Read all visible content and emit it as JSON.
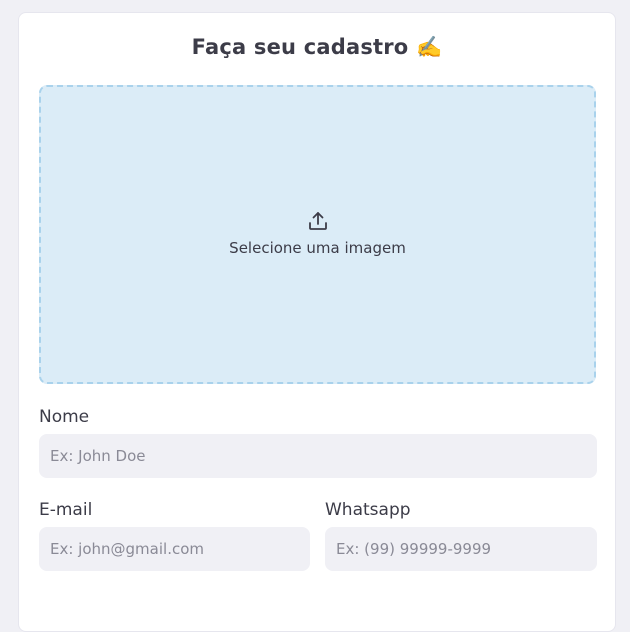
{
  "form": {
    "title": "Faça seu cadastro",
    "title_emoji": "✍️",
    "upload": {
      "icon": "upload-icon",
      "label": "Selecione uma imagem"
    },
    "fields": {
      "name": {
        "label": "Nome",
        "placeholder": "Ex: John Doe",
        "value": ""
      },
      "email": {
        "label": "E-mail",
        "placeholder": "Ex: john@gmail.com",
        "value": ""
      },
      "whatsapp": {
        "label": "Whatsapp",
        "placeholder": "Ex: (99) 99999-9999",
        "value": ""
      }
    }
  },
  "colors": {
    "page_bg": "#f0f0f5",
    "card_bg": "#ffffff",
    "dropzone_bg": "#dbecf7",
    "dropzone_border": "#a9d2ec",
    "input_bg": "#f0f0f5",
    "text": "#3c3c48",
    "placeholder": "#8a8a96"
  }
}
